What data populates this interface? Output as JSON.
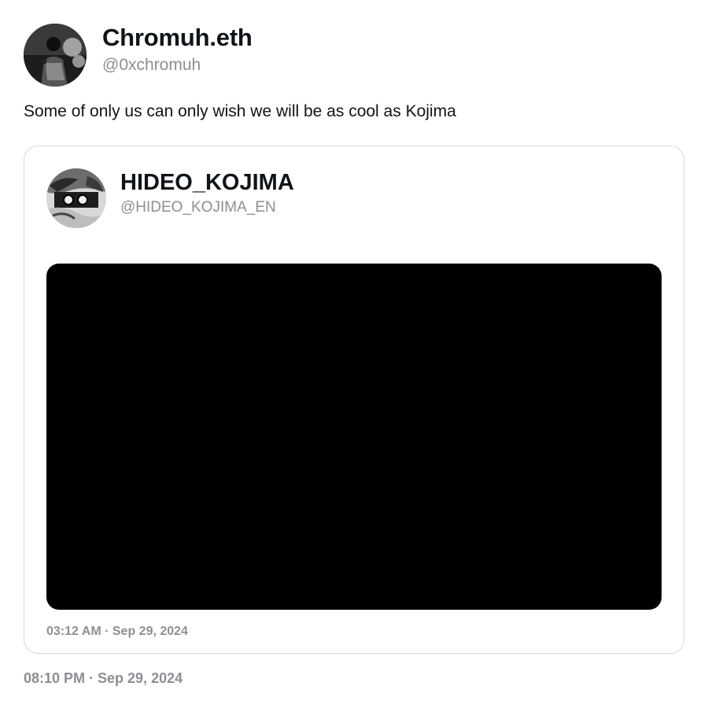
{
  "tweet": {
    "author": {
      "name": "Chromuh.eth",
      "handle": "@0xchromuh",
      "avatar_icon": "profile-photo-icon"
    },
    "text": "Some of only us can only wish we will be as cool as Kojima",
    "timestamp": "08:10 PM · Sep 29, 2024"
  },
  "quoted_tweet": {
    "author": {
      "name": "HIDEO_KOJIMA",
      "handle": "@HIDEO_KOJIMA_EN",
      "avatar_icon": "profile-photo-icon"
    },
    "media": {
      "type": "video",
      "background": "#000000"
    },
    "timestamp": "03:12 AM · Sep 29, 2024"
  },
  "colors": {
    "text_primary": "#0f1419",
    "text_secondary": "#8b8f94",
    "card_border": "#d6dade",
    "background": "#ffffff"
  }
}
